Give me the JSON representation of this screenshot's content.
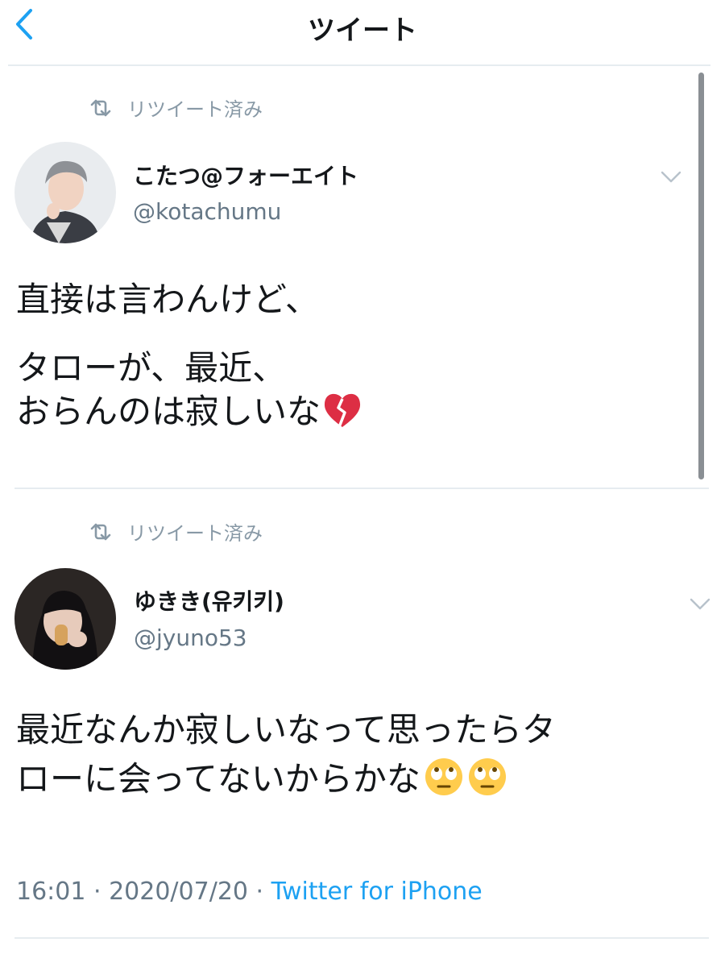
{
  "header": {
    "title": "ツイート"
  },
  "tweets": [
    {
      "retweet_label": "リツイート済み",
      "display_name": "こたつ@フォーエイト",
      "handle": "@kotachumu",
      "lines": [
        "直接は言わんけど、",
        "タローが、最近、",
        "おらんのは寂しいな"
      ],
      "trailing_emoji": "broken-heart"
    },
    {
      "retweet_label": "リツイート済み",
      "display_name": "ゆきき(유키키)",
      "handle": "@jyuno53",
      "lines": [
        "最近なんか寂しいなって思ったらタ",
        "ローに会ってないからかな"
      ],
      "trailing_emoji": "face-with-rolling-eyes"
    }
  ],
  "meta": {
    "time": "16:01",
    "separator": " · ",
    "date": "2020/07/20",
    "source": "Twitter for iPhone"
  },
  "colors": {
    "accent": "#1da1f2",
    "muted": "#657786",
    "text": "#14171a",
    "divider": "#e6ecf0"
  }
}
